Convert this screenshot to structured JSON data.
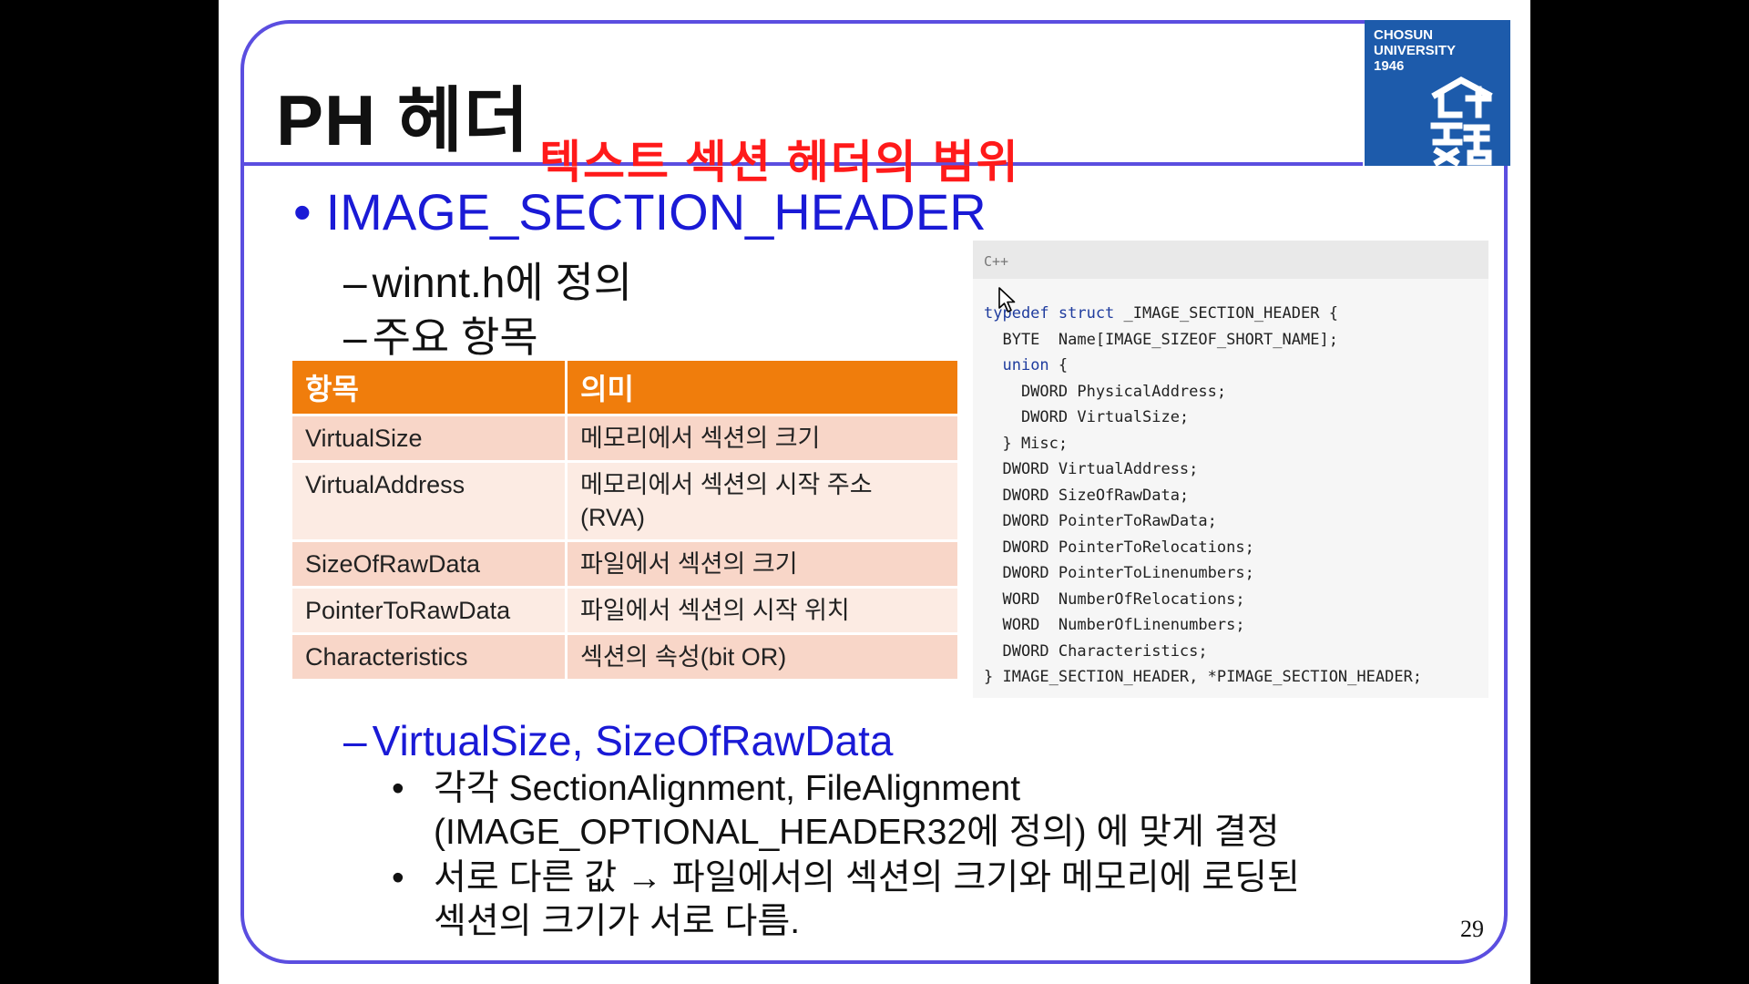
{
  "slide": {
    "title": "PH 헤더",
    "overlay": "텍스트 섹션 헤더의 범위",
    "logo": {
      "line1": "CHOSUN",
      "line2": "UNIVERSITY",
      "line3": "1946"
    },
    "bullet": "IMAGE_SECTION_HEADER",
    "dash1": "winnt.h에 정의",
    "dash2": "주요 항목",
    "table": {
      "headers": [
        "항목",
        "의미"
      ],
      "rows": [
        [
          "VirtualSize",
          "메모리에서 섹션의 크기"
        ],
        [
          "VirtualAddress",
          "메모리에서 섹션의 시작 주소 (RVA)"
        ],
        [
          "SizeOfRawData",
          "파일에서 섹션의 크기"
        ],
        [
          "PointerToRawData",
          "파일에서 섹션의 시작 위치"
        ],
        [
          "Characteristics",
          "섹션의 속성(bit OR)"
        ]
      ]
    },
    "code": {
      "lang": "C++",
      "lines": [
        "typedef struct _IMAGE_SECTION_HEADER {",
        "  BYTE  Name[IMAGE_SIZEOF_SHORT_NAME];",
        "  union {",
        "    DWORD PhysicalAddress;",
        "    DWORD VirtualSize;",
        "  } Misc;",
        "  DWORD VirtualAddress;",
        "  DWORD SizeOfRawData;",
        "  DWORD PointerToRawData;",
        "  DWORD PointerToRelocations;",
        "  DWORD PointerToLinenumbers;",
        "  WORD  NumberOfRelocations;",
        "  WORD  NumberOfLinenumbers;",
        "  DWORD Characteristics;",
        "} IMAGE_SECTION_HEADER, *PIMAGE_SECTION_HEADER;"
      ]
    },
    "dash3": "VirtualSize, SizeOfRawData",
    "sub1_line1": "각각 SectionAlignment, FileAlignment",
    "sub1_line2": "(IMAGE_OPTIONAL_HEADER32에 정의) 에 맞게 결정",
    "sub2_line1": "서로 다른 값 → 파일에서의 섹션의 크기와 메모리에 로딩된",
    "sub2_line2": "섹션의 크기가 서로 다름.",
    "page_number": "29",
    "colors": {
      "accent": "#5b4ee0",
      "table_header": "#f07d0c",
      "overlay": "#ff1a1a",
      "blue_text": "#1a1ad6",
      "logo_bg": "#1d5bab"
    },
    "icons": {
      "cursor": "mouse-pointer-icon"
    }
  }
}
